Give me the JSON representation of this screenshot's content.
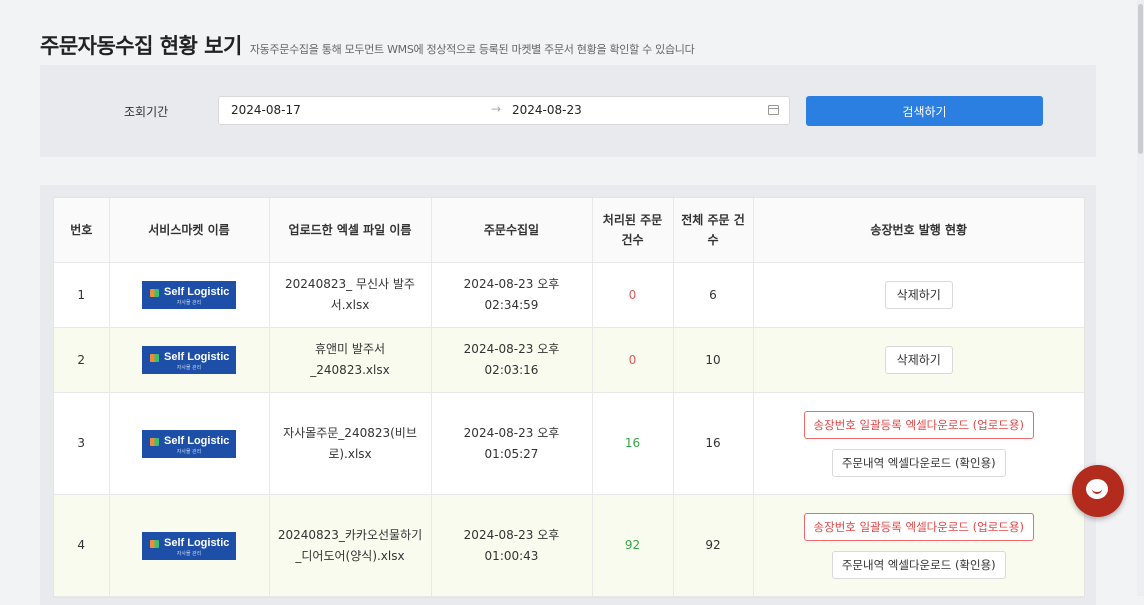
{
  "header": {
    "title": "주문자동수집 현황 보기",
    "subtitle": "자동주문수집을 통해 모두먼트 WMS에 정상적으로 등록된 마켓별 주문서 현황을 확인할 수 있습니다"
  },
  "search": {
    "label": "조회기간",
    "start_date": "2024-08-17",
    "arrow": "→",
    "end_date": "2024-08-23",
    "button": "검색하기"
  },
  "table": {
    "columns": [
      "번호",
      "서비스마켓 이름",
      "업로드한 엑셀 파일 이름",
      "주문수집일",
      "처리된 주문 건수",
      "전체 주문 건수",
      "송장번호 발행 현황"
    ],
    "logo": {
      "name": "Self Logistic",
      "tagline": "자사몰 관리"
    },
    "rows": [
      {
        "no": "1",
        "file": "20240823_ 무신사 발주서.xlsx",
        "date": "2024-08-23 오후 02:34:59",
        "processed": "0",
        "total": "6",
        "action": "삭제하기"
      },
      {
        "no": "2",
        "file": "휴앤미 발주서_240823.xlsx",
        "date": "2024-08-23 오후 02:03:16",
        "processed": "0",
        "total": "10",
        "action": "삭제하기"
      },
      {
        "no": "3",
        "file": "자사몰주문_240823(비브로).xlsx",
        "date": "2024-08-23 오후 01:05:27",
        "processed": "16",
        "total": "16",
        "action_primary": "송장번호 일괄등록 엑셀다운로드 (업로드용)",
        "action_secondary": "주문내역 엑셀다운로드 (확인용)"
      },
      {
        "no": "4",
        "file": "20240823_카카오선물하기_디어도어(양식).xlsx",
        "date": "2024-08-23 오후 01:00:43",
        "processed": "92",
        "total": "92",
        "action_primary": "송장번호 일괄등록 엑셀다운로드 (업로드용)",
        "action_secondary": "주문내역 엑셀다운로드 (확인용)"
      }
    ]
  },
  "colors": {
    "primary": "#2b7fe0",
    "danger": "#e04848",
    "success": "#36a547",
    "chat": "#b22b1c"
  },
  "icons": {
    "calendar": "calendar-icon",
    "chat": "chat-icon"
  }
}
